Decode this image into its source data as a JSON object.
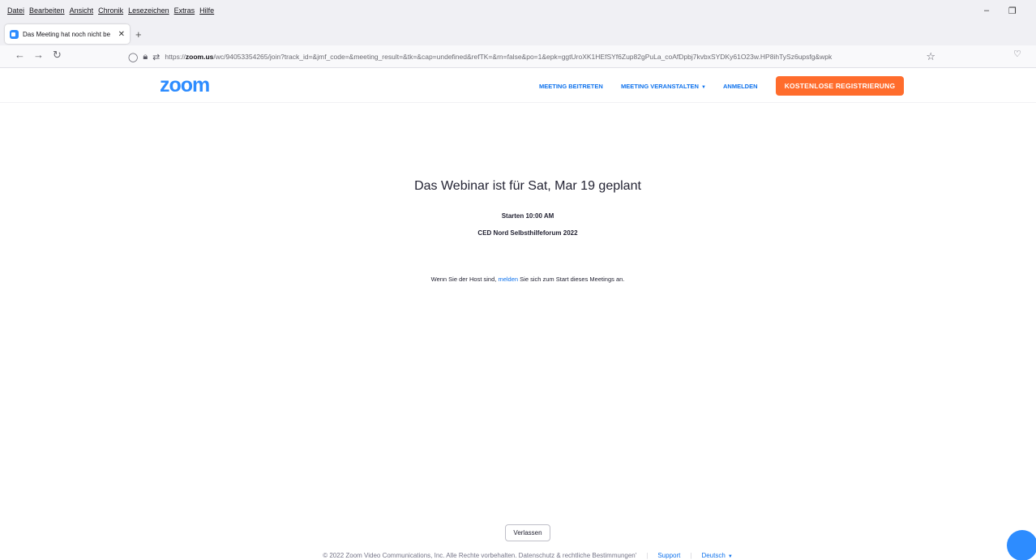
{
  "browser": {
    "menu": [
      "Datei",
      "Bearbeiten",
      "Ansicht",
      "Chronik",
      "Lesezeichen",
      "Extras",
      "Hilfe"
    ],
    "tab_title": "Das Meeting hat noch nicht be",
    "url_prefix": "https://",
    "url_domain": "zoom.us",
    "url_rest": "/wc/94053354265/join?track_id=&jmf_code=&meeting_result=&tk=&cap=undefined&refTK=&rn=false&po=1&epk=ggtUroXK1HEfSYf6Zup82gPuLa_coAfDpbj7kvbxSYDKy61O23w.HP8ihTySz6upsfg&wpk"
  },
  "header": {
    "logo": "zoom",
    "nav": {
      "join": "MEETING BEITRETEN",
      "host": "MEETING VERANSTALTEN",
      "signin": "ANMELDEN",
      "register": "KOSTENLOSE REGISTRIERUNG"
    }
  },
  "main": {
    "title": "Das Webinar ist für Sat, Mar 19 geplant",
    "start_time": "Starten 10:00 AM",
    "topic": "CED Nord Selbsthilfeforum 2022",
    "host_prefix": "Wenn Sie der Host sind, ",
    "host_link": "melden",
    "host_suffix": " Sie sich zum Start dieses Meetings an.",
    "leave_label": "Verlassen"
  },
  "footer": {
    "copyright": "© 2022 Zoom Video Communications, Inc. Alle Rechte vorbehalten. Datenschutz & rechtliche Bestimmungen'",
    "support": "Support",
    "language": "Deutsch"
  },
  "colors": {
    "brand_blue": "#2d8cff",
    "link_blue": "#0e72ed",
    "cta_orange": "#ff6c2c"
  },
  "icons": [
    "back-arrow-icon",
    "forward-arrow-icon",
    "reload-icon",
    "shield-icon",
    "lock-icon",
    "permissions-icon",
    "bookmark-star-icon",
    "pocket-icon",
    "chat-bubble-icon"
  ]
}
